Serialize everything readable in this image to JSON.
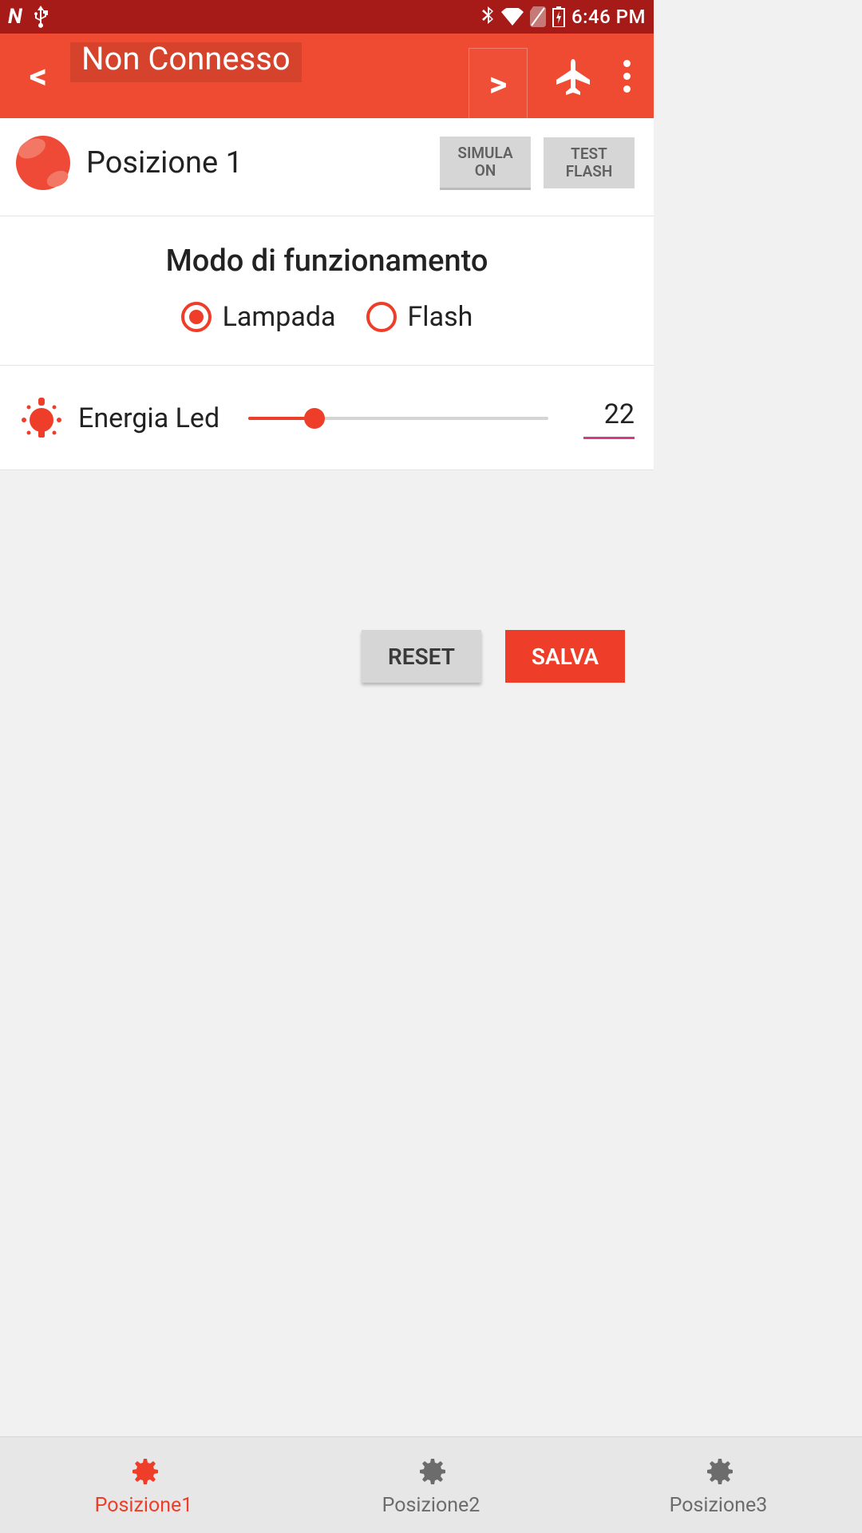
{
  "status": {
    "time": "6:46 PM"
  },
  "appbar": {
    "title": "Non Connesso",
    "prev": "<",
    "next": ">"
  },
  "header": {
    "title": "Posizione 1",
    "simulate_btn": "SIMULA\nON",
    "test_btn": "TEST\nFLASH"
  },
  "mode": {
    "title": "Modo di funzionamento",
    "option_lamp": "Lampada",
    "option_flash": "Flash",
    "selected": "lamp"
  },
  "energy": {
    "label": "Energia Led",
    "value": "22",
    "percent": 22
  },
  "actions": {
    "reset": "RESET",
    "save": "SALVA"
  },
  "tabs": {
    "items": [
      {
        "label": "Posizione1",
        "active": true
      },
      {
        "label": "Posizione2",
        "active": false
      },
      {
        "label": "Posizione3",
        "active": false
      }
    ]
  },
  "colors": {
    "accent": "#ee3e2a"
  }
}
